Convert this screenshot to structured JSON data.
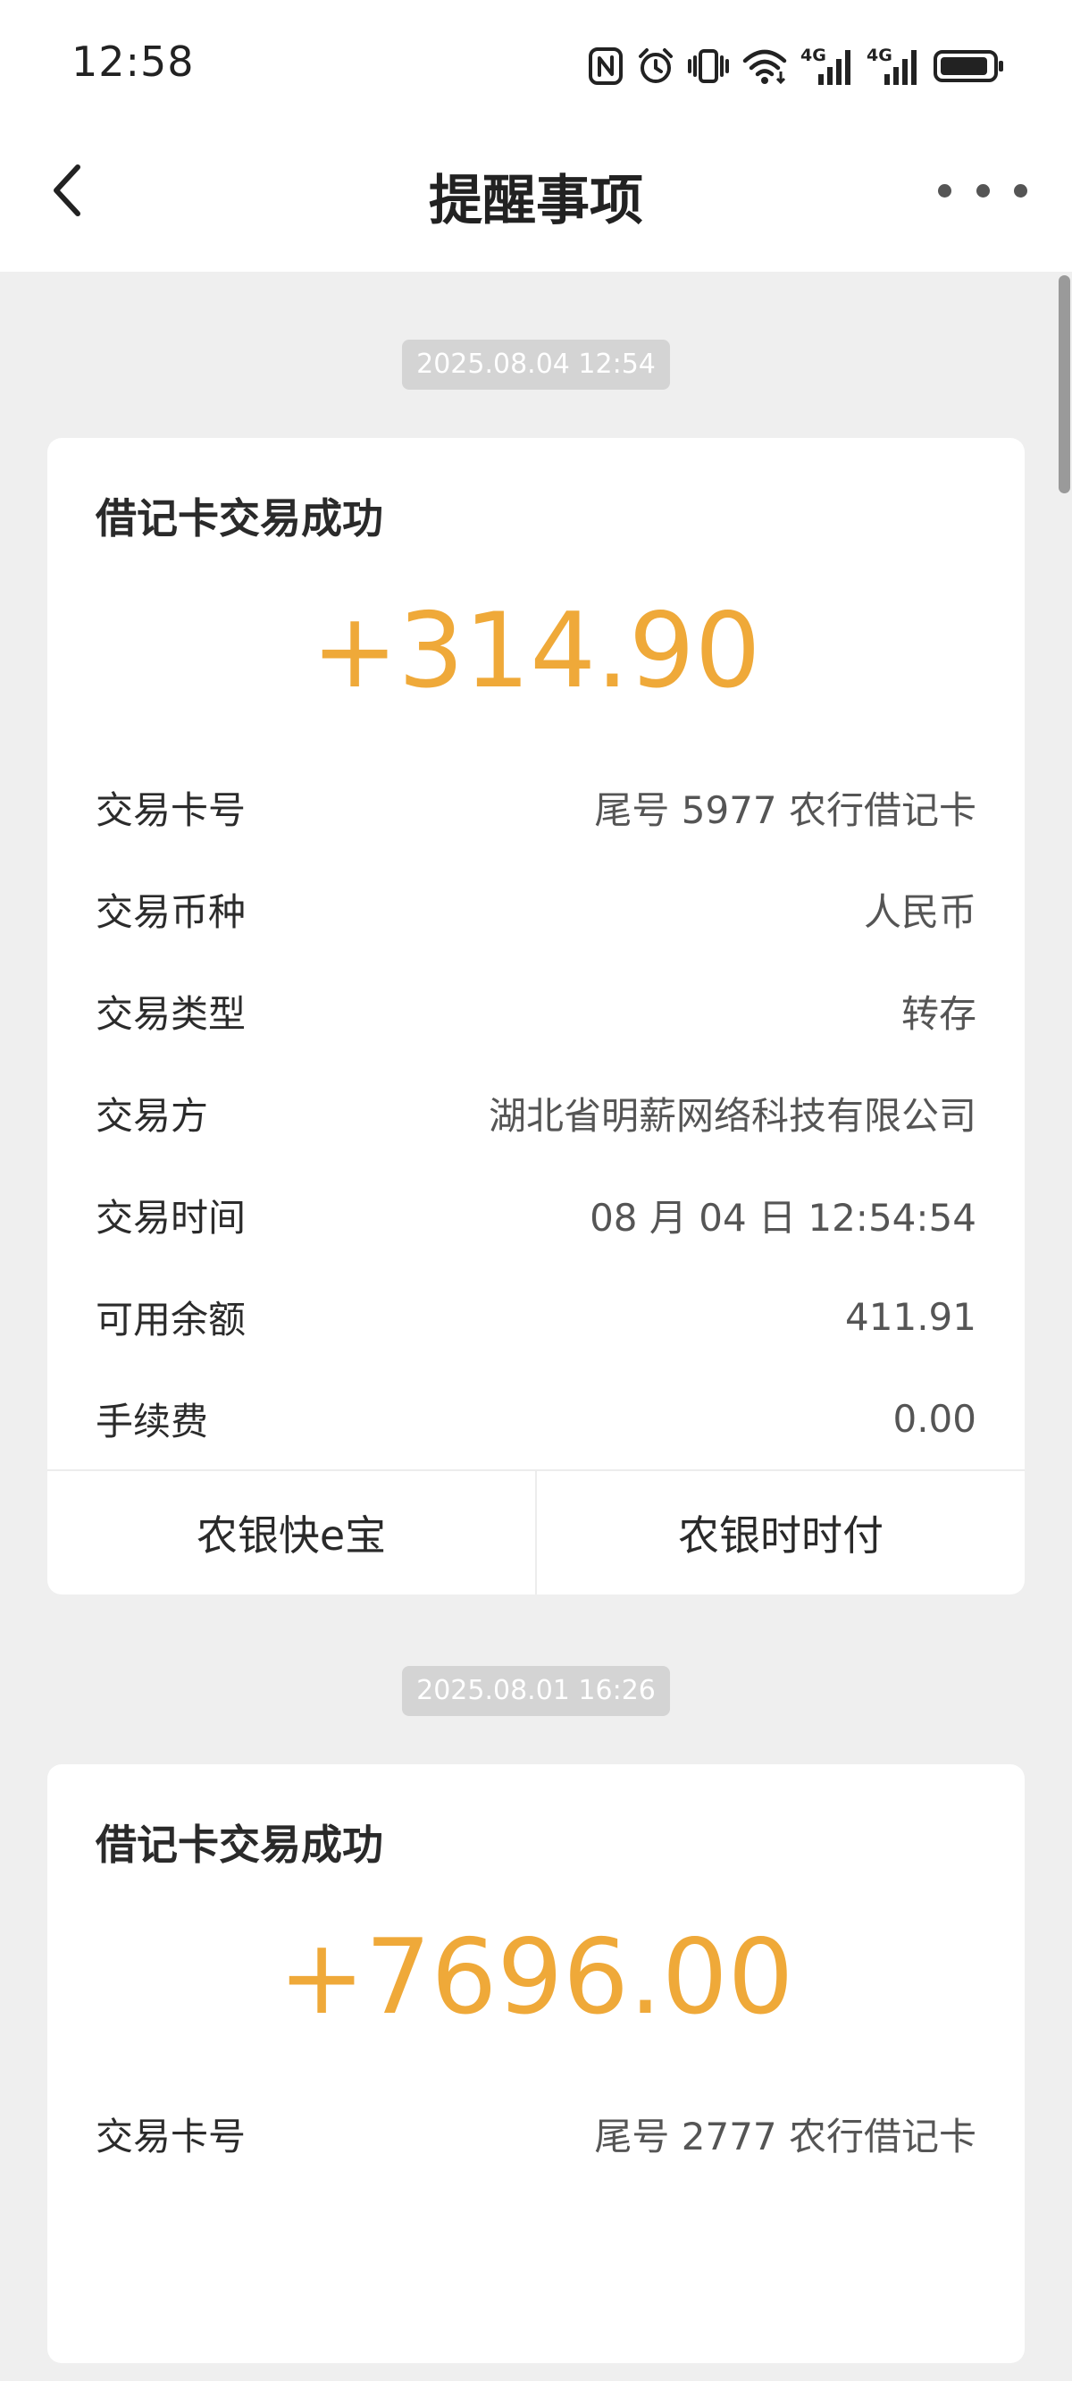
{
  "status_bar": {
    "time": "12:58",
    "icons": [
      "nfc-icon",
      "alarm-icon",
      "vibrate-icon",
      "wifi-icon",
      "signal-4g-icon",
      "signal-4g-icon",
      "battery-icon"
    ],
    "network_label_1": "4G",
    "network_label_2": "4G"
  },
  "nav": {
    "back_icon": "back-chevron-icon",
    "title": "提醒事项",
    "more_icon": "more-dots-icon"
  },
  "messages": [
    {
      "date": "2025.08.04 12:54",
      "title": "借记卡交易成功",
      "amount": "+314.90",
      "rows": [
        {
          "label": "交易卡号",
          "value": "尾号 5977 农行借记卡"
        },
        {
          "label": "交易币种",
          "value": "人民币"
        },
        {
          "label": "交易类型",
          "value": "转存"
        },
        {
          "label": "交易方",
          "value": "湖北省明薪网络科技有限公司"
        },
        {
          "label": "交易时间",
          "value": "08 月 04 日 12:54:54"
        },
        {
          "label": "可用余额",
          "value": "411.91"
        },
        {
          "label": "手续费",
          "value": "0.00"
        }
      ],
      "actions": [
        "农银快e宝",
        "农银时时付"
      ]
    },
    {
      "date": "2025.08.01 16:26",
      "title": "借记卡交易成功",
      "amount": "+7696.00",
      "rows": [
        {
          "label": "交易卡号",
          "value": "尾号 2777 农行借记卡"
        }
      ]
    }
  ],
  "colors": {
    "amount": "#efa939",
    "background": "#efefef",
    "card": "#ffffff",
    "date_pill": "#d4d4d4"
  }
}
